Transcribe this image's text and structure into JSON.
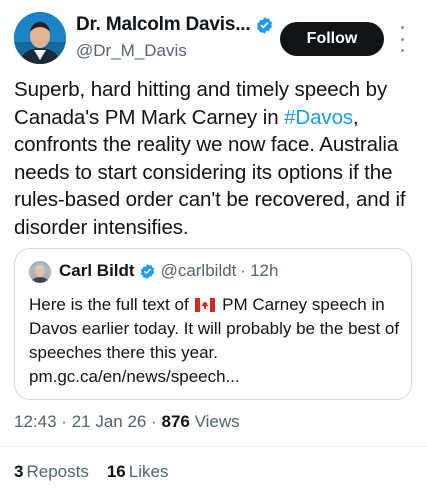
{
  "author": {
    "display_name": "Dr. Malcolm Davis...",
    "handle": "@Dr_M_Davis"
  },
  "follow_label": "Follow",
  "tweet": {
    "text_before": "Superb, hard hitting and timely speech by Canada's PM Mark Carney in ",
    "hashtag": "#Davos",
    "text_after": ", confronts the reality we now face. Australia needs to start considering its options if the rules-based order can't be recovered, and if disorder intensifies."
  },
  "quote": {
    "name": "Carl Bildt",
    "handle": "@carlbildt",
    "dot": "·",
    "time": "12h",
    "text_before": "Here is the full text of",
    "text_after": "PM Carney speech in Davos earlier today. It will probably be the best of speeches there this year.  pm.gc.ca/en/news/speech..."
  },
  "meta": {
    "time": "12:43",
    "date": "21 Jan 26",
    "views_count": "876",
    "views_label": "Views",
    "sep": "·"
  },
  "stats": {
    "reposts_count": "3",
    "reposts_label": "Reposts",
    "likes_count": "16",
    "likes_label": "Likes"
  },
  "colors": {
    "accent": "#1d9bf0",
    "verified": "#1d9bf0",
    "text": "#0f1419",
    "secondary": "#536471"
  },
  "icons": {
    "verified": "verified-badge-icon",
    "more": "more-dots-icon",
    "flag": "canada-flag-icon"
  }
}
